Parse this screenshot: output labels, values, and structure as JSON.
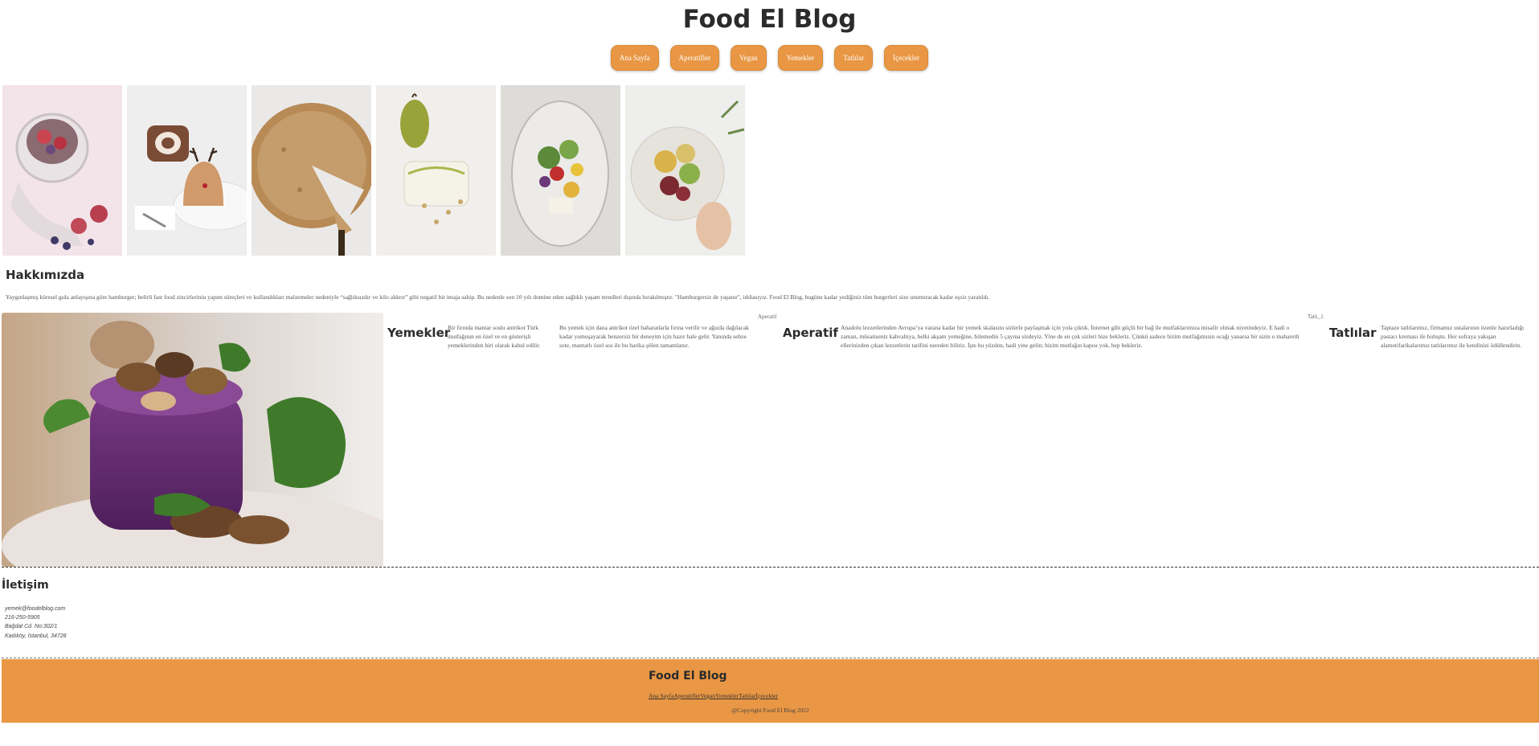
{
  "site": {
    "title": "Food El Blog"
  },
  "nav": [
    {
      "label": "Ana Sayfa"
    },
    {
      "label": "Aperatifler"
    },
    {
      "label": "Vegan"
    },
    {
      "label": "Yemekler"
    },
    {
      "label": "Tatlılar"
    },
    {
      "label": "İçecekler"
    }
  ],
  "gallery": [
    {
      "name": "chia-pudding-figs"
    },
    {
      "name": "reindeer-cake"
    },
    {
      "name": "pie-slice"
    },
    {
      "name": "pear-dessert"
    },
    {
      "name": "salad-glass"
    },
    {
      "name": "salad-bowl"
    }
  ],
  "about": {
    "title": "Hakkımızda",
    "text": "Yaygınlaşmış küresel gıda anlayışına göre hamburger; belirli fast food zincirlerinin yapım süreçleri ve kullandıkları malzemeler nedeniyle “sağlıksızdır ve kilo aldırır” gibi negatif bir imaja sahip. Bu nedenle son 10 yılı domine eden sağlıklı yaşam trendleri dışında bırakılmıştır. \"Hamburgersiz de yaşanır\", iddiasıyız. Food El Blog, bugüne kadar yediğiniz tüm burgerleri size unutturacak kadar eşsiz yaratıldı."
  },
  "categories": {
    "yemekler": {
      "title": "Yemekler",
      "text1": "Bir fırında mantar soslu antrikot Türk mutfağının en özel ve en gösterişli yemeklerinden biri olarak kabul edilir.",
      "text2": "Bu yemek için dana antrikot özel baharatlarla fırına verilir ve ağızda dağılacak kadar yumuşayarak benzersiz bir deneyim için hazır hale gelir. Yanında sebze sote, mantarlı özel sos ile bu harika şölen tamamlanır."
    },
    "aperatif": {
      "alt": "Aperatif",
      "title": "Aperatif",
      "text": "Anadolu lezzetlerinden Avrupa’ya varana kadar bir yemek skalasını sizlerle paylaşmak için yola çıktık. İnternet gibi güçlü bir bağ ile mutfaklarımıza misafir olmak niyetindeyiz. E hadi o zaman, müsaitseniz kahvaltıya, belki akşam yemeğine, bilemedin 5 çayına sizdeyiz. Yine de en çok sizleri bize bekleriz. Çünkü sadece bizim mutfağımızın ocağı yanarsa bir sizin o maharetli ellerinizden çıkan lezzetlerin tarifini nereden biliriz. İşte bu yüzden, hadi yine gelin; bizim mutfağın kapısı yok, hep bekleriz."
    },
    "tatlilar": {
      "alt": "Tatlı_1",
      "title": "Tatlılar",
      "text": "Taptaze tatlılarımız, firmamız ustalarının özenle hazırladığı pastacı kreması ile buluştu. Her sofraya yakışan alametifarikalarımız tatlılarımız ile kendinizi ödüllendirin."
    }
  },
  "contact": {
    "title": "İletişim",
    "email": "yemek@foodelblog.com",
    "phone": "216-250-5905",
    "address1": "Bağdat Cd. No:302/1",
    "address2": "Kadıköy, İstanbul, 34728"
  },
  "footer": {
    "title": "Food El Blog",
    "links": [
      {
        "label": "Ana Sayfa"
      },
      {
        "label": "Aperatifler"
      },
      {
        "label": "Vegan"
      },
      {
        "label": "Yemekler"
      },
      {
        "label": "Tatlılar"
      },
      {
        "label": "İçecekler"
      }
    ],
    "copyright": "@Copyright Food El Blog 2022"
  },
  "colors": {
    "accent": "#e99744",
    "heading": "#2b2b2b",
    "text": "#555555"
  }
}
